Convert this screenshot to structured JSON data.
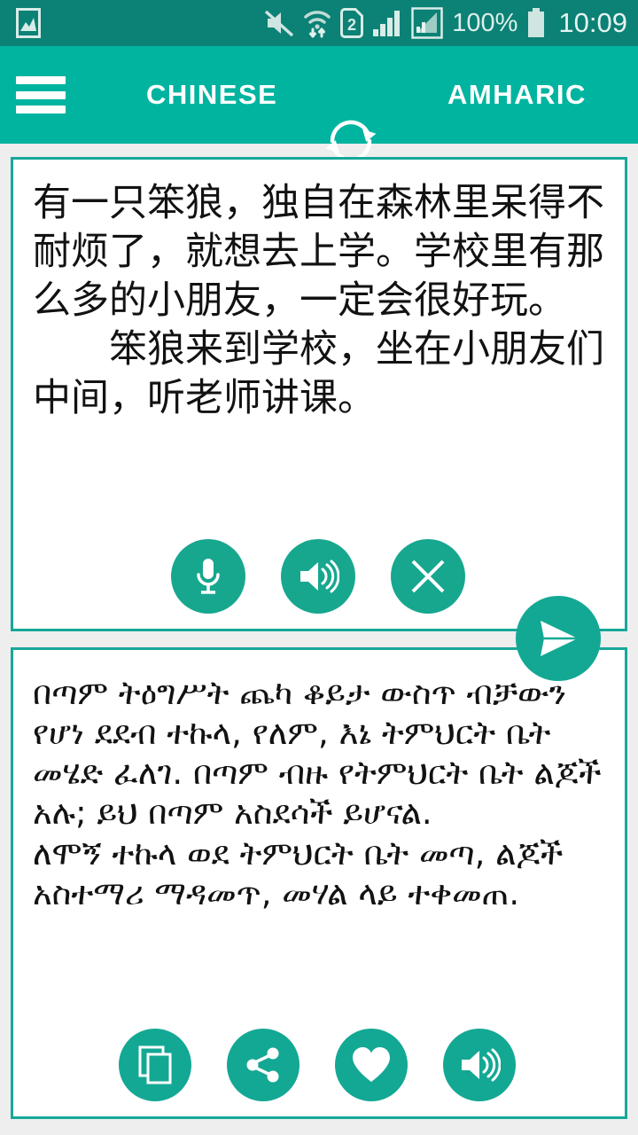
{
  "status_bar": {
    "battery_percent": "100%",
    "time": "10:09",
    "icons": [
      "screenshot-icon",
      "mute-icon",
      "wifi-icon",
      "sim2-icon",
      "signal-bars-icon",
      "signal-bars-secondary-icon",
      "battery-icon"
    ]
  },
  "app_bar": {
    "menu_label": "menu-icon",
    "source_language": "CHINESE",
    "swap_label": "swap-languages-icon",
    "target_language": "AMHARIC"
  },
  "source_card": {
    "text": "有一只笨狼，独自在森林里呆得不耐烦了，就想去上学。学校里有那么多的小朋友，一定会很好玩。\n　　笨狼来到学校，坐在小朋友们中间，听老师讲课。",
    "buttons": [
      {
        "name": "microphone-button",
        "icon": "microphone-icon"
      },
      {
        "name": "speak-source-button",
        "icon": "speaker-icon"
      },
      {
        "name": "clear-button",
        "icon": "close-icon"
      }
    ]
  },
  "translate_button": {
    "name": "translate-send-button",
    "icon": "send-icon"
  },
  "target_card": {
    "text": "በጣም ትዕግሥት ጨካ ቆይታ ውስጥ ብቻውን የሆነ ደደብ ተኩላ, የለም, እኔ ትምህርት ቤት መሄድ ፈለገ. በጣም ብዙ የትምህርት ቤት ልጆች አሉ; ይህ በጣም አስደሳች ይሆናል.\nለሞኝ ተኩላ ወደ ትምህርት ቤት መጣ, ልጆች አስተማሪ ማዳመጥ, መሃል ላይ ተቀመጠ.",
    "buttons": [
      {
        "name": "copy-button",
        "icon": "copy-icon"
      },
      {
        "name": "share-button",
        "icon": "share-icon"
      },
      {
        "name": "favorite-button",
        "icon": "heart-icon"
      },
      {
        "name": "speak-target-button",
        "icon": "speaker-icon"
      }
    ]
  },
  "colors": {
    "status_bar": "#0c8175",
    "app_bar": "#00b4a0",
    "accent": "#13a894",
    "card_border": "#17a79a",
    "page_background": "#eeeeee"
  }
}
